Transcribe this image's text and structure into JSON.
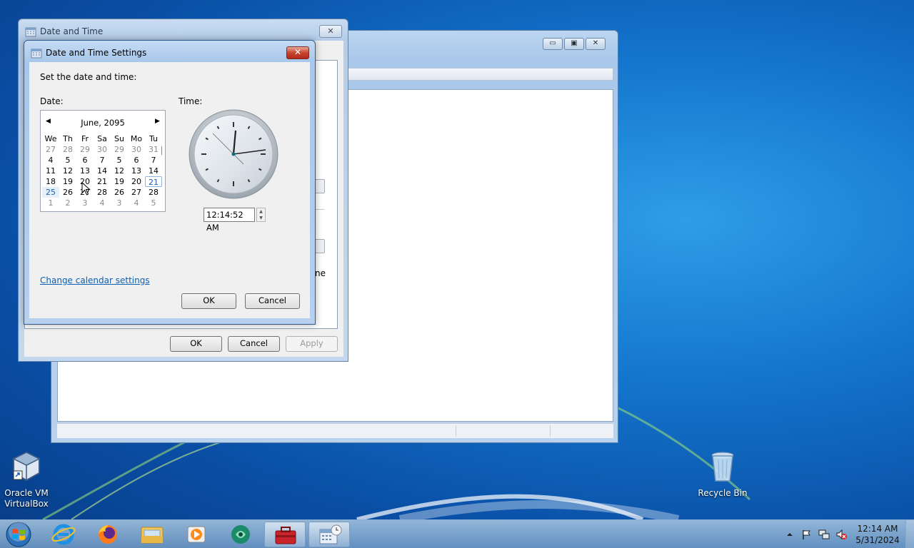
{
  "desktop": {
    "icons": [
      {
        "label_line1": "Oracle VM",
        "label_line2": "VirtualBox",
        "icon": "virtualbox-icon"
      },
      {
        "label_line1": "Recycle Bin",
        "icon": "recycle-bin-icon"
      }
    ]
  },
  "date_time_window": {
    "title": "Date and Time",
    "partial_text": "ne",
    "buttons": {
      "ok": "OK",
      "cancel": "Cancel",
      "apply": "Apply"
    }
  },
  "settings_dialog": {
    "title": "Date and Time Settings",
    "instruction": "Set the date and time:",
    "date_label": "Date:",
    "time_label": "Time:",
    "calendar": {
      "month_year": "June, 2095",
      "weekdays": [
        "We",
        "Th",
        "Fr",
        "Sa",
        "Su",
        "Mo",
        "Tu"
      ],
      "weeks": [
        [
          "27",
          "28",
          "29",
          "30",
          "29",
          "30",
          "31"
        ],
        [
          "4",
          "5",
          "6",
          "7",
          "5",
          "6",
          "7"
        ],
        [
          "11",
          "12",
          "13",
          "14",
          "12",
          "13",
          "14"
        ],
        [
          "18",
          "19",
          "20",
          "21",
          "19",
          "20",
          "21"
        ],
        [
          "25",
          "26",
          "27",
          "28",
          "26",
          "27",
          "28"
        ],
        [
          "1",
          "2",
          "3",
          "4",
          "3",
          "4",
          "5"
        ]
      ],
      "muted_rows": [
        0,
        5
      ],
      "selected_day": "21"
    },
    "time_value": "12:14:52 AM",
    "change_calendar_link": "Change calendar settings",
    "buttons": {
      "ok": "OK",
      "cancel": "Cancel"
    }
  },
  "taskbar": {
    "clock_time": "12:14 AM",
    "clock_date": "5/31/2024",
    "pinned": [
      {
        "icon": "internet-explorer-icon"
      },
      {
        "icon": "firefox-icon"
      },
      {
        "icon": "file-explorer-icon"
      },
      {
        "icon": "media-player-icon"
      },
      {
        "icon": "green-app-icon"
      },
      {
        "icon": "toolbox-icon"
      },
      {
        "icon": "date-time-icon"
      }
    ],
    "tray_icons": [
      "show-hidden-icons-icon",
      "action-center-flag-icon",
      "network-icon",
      "volume-muted-icon"
    ]
  }
}
